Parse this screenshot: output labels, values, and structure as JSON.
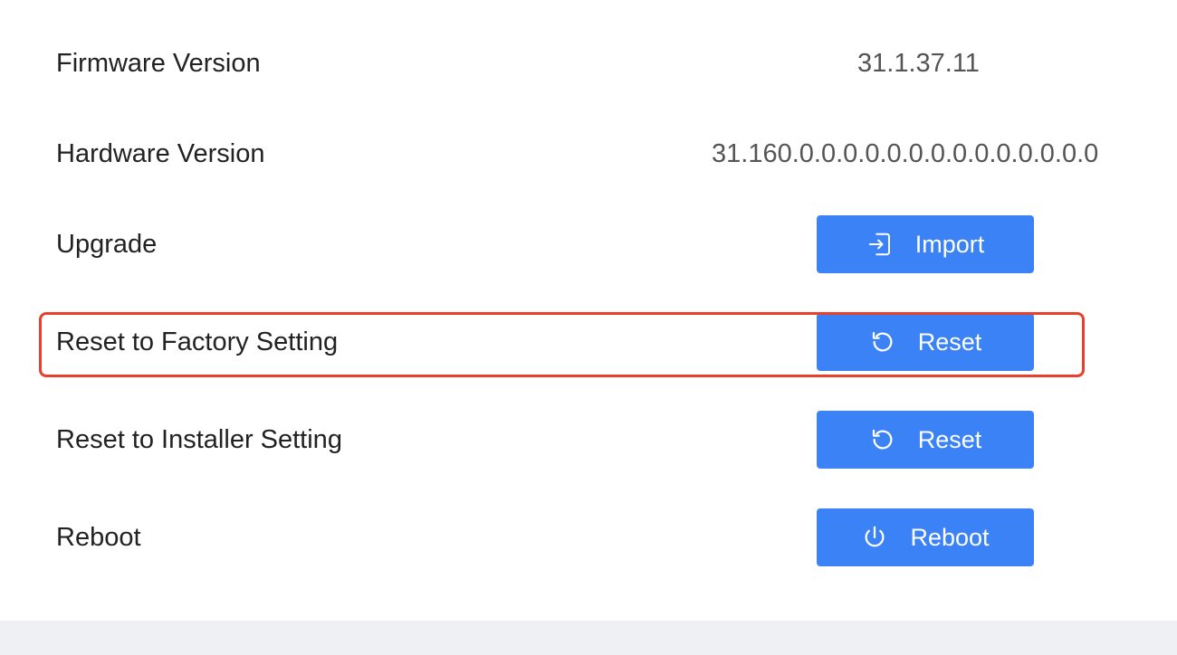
{
  "rows": [
    {
      "label": "Firmware Version",
      "value": "31.1.37.11"
    },
    {
      "label": "Hardware Version",
      "value": "31.160.0.0.0.0.0.0.0.0.0.0.0.0.0.0"
    },
    {
      "label": "Upgrade",
      "button": "Import",
      "icon": "import-icon"
    },
    {
      "label": "Reset to Factory Setting",
      "button": "Reset",
      "icon": "reset-icon"
    },
    {
      "label": "Reset to Installer Setting",
      "button": "Reset",
      "icon": "reset-icon"
    },
    {
      "label": "Reboot",
      "button": "Reboot",
      "icon": "power-icon"
    }
  ],
  "colors": {
    "button": "#3b82f6",
    "highlight": "#e8402a",
    "footer": "#eef0f4"
  }
}
